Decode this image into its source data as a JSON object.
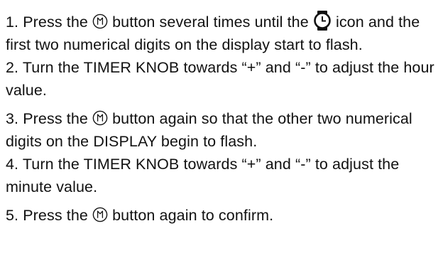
{
  "steps": [
    {
      "number": "1.",
      "text_a": "Press the",
      "text_b": "button several times until the",
      "text_c": "icon and the first two numerical digits on the display start to flash."
    },
    {
      "number": "2.",
      "text": "Turn the TIMER KNOB towards “+” and “-”  to adjust the hour value."
    },
    {
      "number": "3.",
      "text_a": "Press the",
      "text_b": "button again so that the other two numerical digits on the DISPLAY begin to flash."
    },
    {
      "number": "4.",
      "text": "Turn the TIMER KNOB towards “+” and “-”  to adjust the minute value."
    },
    {
      "number": "5.",
      "text_a": "Press the",
      "text_b": "button again to confirm."
    }
  ],
  "icons": {
    "button_icon": "timer-button-icon",
    "clock_icon": "clock-icon"
  }
}
